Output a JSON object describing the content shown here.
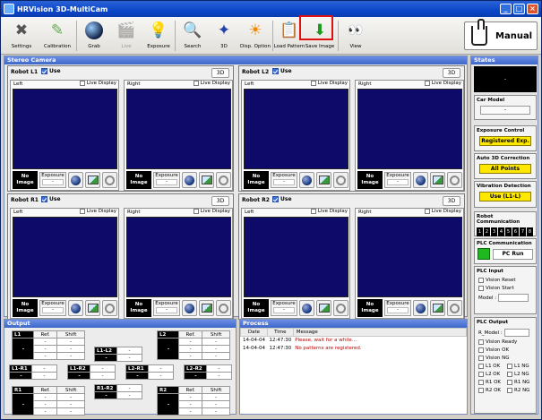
{
  "window": {
    "title": "HRVision 3D-MultiCam"
  },
  "toolbar": {
    "settings": "Settings",
    "calibration": "Calibration",
    "grab": "Grab",
    "live": "Live",
    "exposure": "Exposure",
    "search": "Search",
    "three_d": "3D",
    "disp_option": "Disp. Option",
    "load_pattern": "Load Pattern",
    "save_image": "Save Image",
    "view": "View"
  },
  "mode": {
    "label": "Manual"
  },
  "stereo": {
    "title": "Stereo Camera",
    "use_label": "Use",
    "three_d_button": "3D",
    "left_label": "Left",
    "right_label": "Right",
    "live_display_label": "Live Display",
    "no_image_line1": "No",
    "no_image_line2": "Image",
    "exposure_label": "Exposure",
    "exposure_value": "-",
    "robots": [
      {
        "name": "Robot L1"
      },
      {
        "name": "Robot L2"
      },
      {
        "name": "Robot R1"
      },
      {
        "name": "Robot R2"
      }
    ]
  },
  "output": {
    "title": "Output",
    "ref_label": "Ref.",
    "shift_label": "Shift",
    "dash": "-",
    "robots": [
      "L1",
      "L2",
      "R1",
      "R2"
    ],
    "pairs": [
      "L1-L2",
      "L1-R1",
      "L1-R2",
      "L2-R1",
      "L2-R2",
      "R1-R2"
    ]
  },
  "process": {
    "title": "Process",
    "columns": [
      "Date",
      "Time",
      "Message"
    ],
    "rows": [
      {
        "date": "14-04-04",
        "time": "12:47:30",
        "message": "Please, wait for a while..."
      },
      {
        "date": "14-04-04",
        "time": "12:47:30",
        "message": "No patterns are registered."
      }
    ]
  },
  "states": {
    "title": "States",
    "display_value": "-",
    "car_model_label": "Car Model",
    "car_model_value": "-",
    "exposure_control_label": "Exposure Control",
    "exposure_control_value": "Registered Exp.",
    "auto_3d_label": "Auto 3D Correction",
    "auto_3d_value": "All Points",
    "vibration_label": "Vibration Detection",
    "vibration_value": "Use (L1-L)",
    "robot_comm_label": "Robot Communication",
    "robot_comm_digits": [
      "1",
      "2",
      "3",
      "4",
      "5",
      "6",
      "7",
      "8"
    ],
    "plc_comm_label": "PLC Communication",
    "plc_comm_value": "PC Run",
    "plc_input_label": "PLC Input",
    "vision_reset": "Vision Reset",
    "vision_start": "Vision Start",
    "model_label": "Model :",
    "plc_output_label": "PLC Output",
    "r_model_label": "R_Model :",
    "vision_ready": "Vision Ready",
    "vision_ok": "Vision OK",
    "vision_ng": "Vision NG",
    "l1_ok": "L1 OK",
    "l1_ng": "L1 NG",
    "l2_ok": "L2 OK",
    "l2_ng": "L2 NG",
    "r1_ok": "R1 OK",
    "r1_ng": "R1 NG",
    "r2_ok": "R2 OK",
    "r2_ng": "R2 NG"
  },
  "colors": {
    "accent_blue": "#3e67c8",
    "view_bg": "#0d0a6a",
    "status_yellow": "#ffe800",
    "comm_green": "#1fb81f"
  }
}
